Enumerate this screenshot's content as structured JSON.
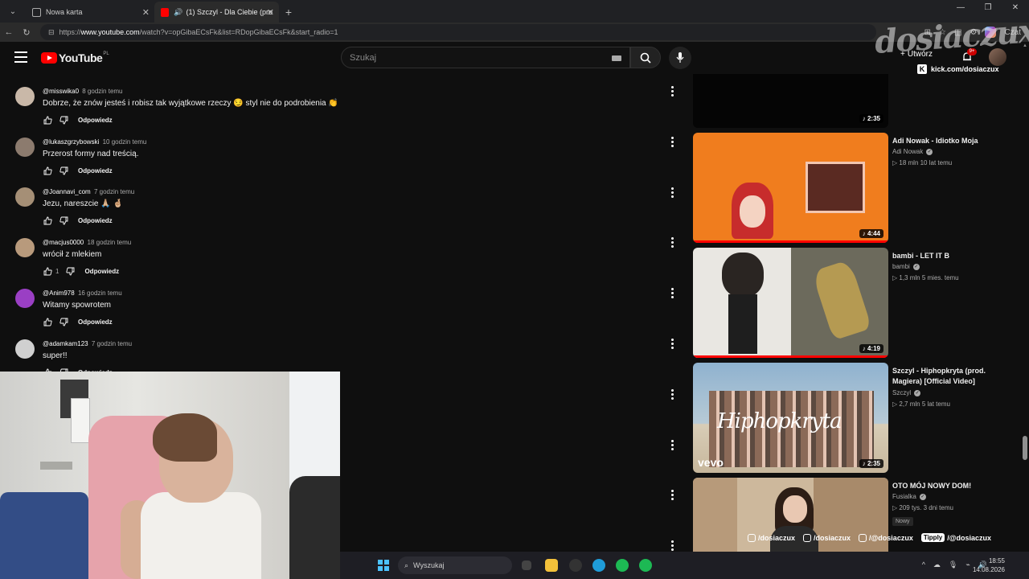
{
  "browser": {
    "tabs": [
      {
        "label": "Nowa karta"
      },
      {
        "label": "(1) Szczyl - Dla Ciebie (prod."
      }
    ],
    "url_prefix": "https://",
    "url_host": "www.youtube.com",
    "url_path": "/watch?v=opGibaECsFk&list=RDopGibaECsFk&start_radio=1",
    "copilot_label": "Czat"
  },
  "youtube": {
    "logo_text": "YouTube",
    "logo_country": "PL",
    "search_placeholder": "Szukaj",
    "create_label": "Utwórz",
    "notif_count": "9+"
  },
  "comments": [
    {
      "author": "@misswika0",
      "time": "8 godzin temu",
      "text": "Dobrze, że znów jesteś i robisz tak wyjątkowe rzeczy 😏 styl nie do podrobienia 👏",
      "likes": "",
      "reply": "Odpowiedz",
      "avatar_color": "#c9b8a8"
    },
    {
      "author": "@lukaszgrzybowski",
      "time": "10 godzin temu",
      "text": "Przerost formy nad treścią.",
      "likes": "",
      "reply": "Odpowiedz",
      "avatar_color": "#8c7b6e"
    },
    {
      "author": "@Joannavi_com",
      "time": "7 godzin temu",
      "text": "Jezu, nareszcie 🙏🏼 🤞🏼",
      "likes": "",
      "reply": "Odpowiedz",
      "avatar_color": "#a58f76"
    },
    {
      "author": "@macjus0000",
      "time": "18 godzin temu",
      "text": "wrócił z mlekiem",
      "likes": "1",
      "reply": "Odpowiedz",
      "avatar_color": "#b89a7c"
    },
    {
      "author": "@Anim978",
      "time": "16 godzin temu",
      "text": "Witamy spowrotem",
      "likes": "",
      "reply": "Odpowiedz",
      "avatar_color": "#9a3fc4"
    },
    {
      "author": "@adamkam123",
      "time": "7 godzin temu",
      "text": "super!!",
      "likes": "",
      "reply": "Odpowiedz",
      "avatar_color": "#d0d0d0"
    }
  ],
  "related": [
    {
      "title": "",
      "channel": "",
      "stats": "",
      "duration": "2:35",
      "thumb_style": "dark",
      "progress": 0
    },
    {
      "title": "Adi Nowak - Idiotko Moja",
      "channel": "Adi Nowak",
      "stats": "18 mln  10 lat temu",
      "duration": "4:44",
      "thumb_style": "orange",
      "progress": 1.0
    },
    {
      "title": "bambi - LET IT B",
      "channel": "bambi",
      "stats": "1,3 mln  5 mies. temu",
      "duration": "4:19",
      "thumb_style": "bambi",
      "progress": 1.0
    },
    {
      "title": "Szczyl - Hiphopkryta (prod. Magiera) [Official Video]",
      "channel": "Szczyl",
      "stats": "2,7 mln  5 lat temu",
      "duration": "2:35",
      "thumb_style": "beach",
      "progress": 0,
      "thumb_text": "Hiphopkryta",
      "vevo": "vevo"
    },
    {
      "title": "OTO MÓJ NOWY DOM!",
      "channel": "Fusialka",
      "stats": "209 tys.  3 dni temu",
      "duration": "",
      "thumb_style": "room",
      "progress": 0,
      "badge": "Nowy"
    }
  ],
  "overlay": {
    "watermark": "dosiaczux",
    "kick": "kick.com/dosiaczux",
    "socials": [
      {
        "handle": "/dosiaczux"
      },
      {
        "handle": "/dosiaczux"
      },
      {
        "handle": "/@dosiaczux"
      }
    ],
    "tipply_label": "Tipply",
    "tipply_handle": "/@dosiaczux"
  },
  "taskbar": {
    "search_placeholder": "Wyszukaj",
    "time": "18:55",
    "date": "14.08.2026"
  }
}
